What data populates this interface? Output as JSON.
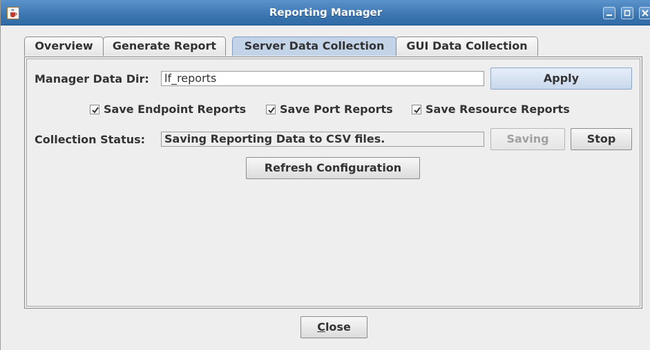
{
  "window": {
    "title": "Reporting Manager",
    "icon": "java-cup-icon",
    "controls": [
      "minimize-icon",
      "maximize-icon",
      "close-icon"
    ]
  },
  "tabs": [
    {
      "label": "Overview",
      "active": false
    },
    {
      "label": "Generate Report",
      "active": false
    },
    {
      "label": "Server Data Collection",
      "active": true
    },
    {
      "label": "GUI Data Collection",
      "active": false
    }
  ],
  "form": {
    "data_dir_label": "Manager Data Dir:",
    "data_dir_value": "lf_reports",
    "apply_label": "Apply",
    "checkboxes": [
      {
        "label": "Save Endpoint Reports",
        "checked": true
      },
      {
        "label": "Save Port Reports",
        "checked": true
      },
      {
        "label": "Save Resource Reports",
        "checked": true
      }
    ],
    "status_label": "Collection Status:",
    "status_value": "Saving Reporting Data to CSV files.",
    "saving_label": "Saving",
    "stop_label": "Stop",
    "refresh_label": "Refresh Configuration"
  },
  "footer": {
    "close_mnemonic": "C",
    "close_rest": "lose"
  },
  "colors": {
    "titlebar": "#3f78b3",
    "active_tab": "#c4d4e8",
    "apply_button": "#c9d8ec"
  }
}
